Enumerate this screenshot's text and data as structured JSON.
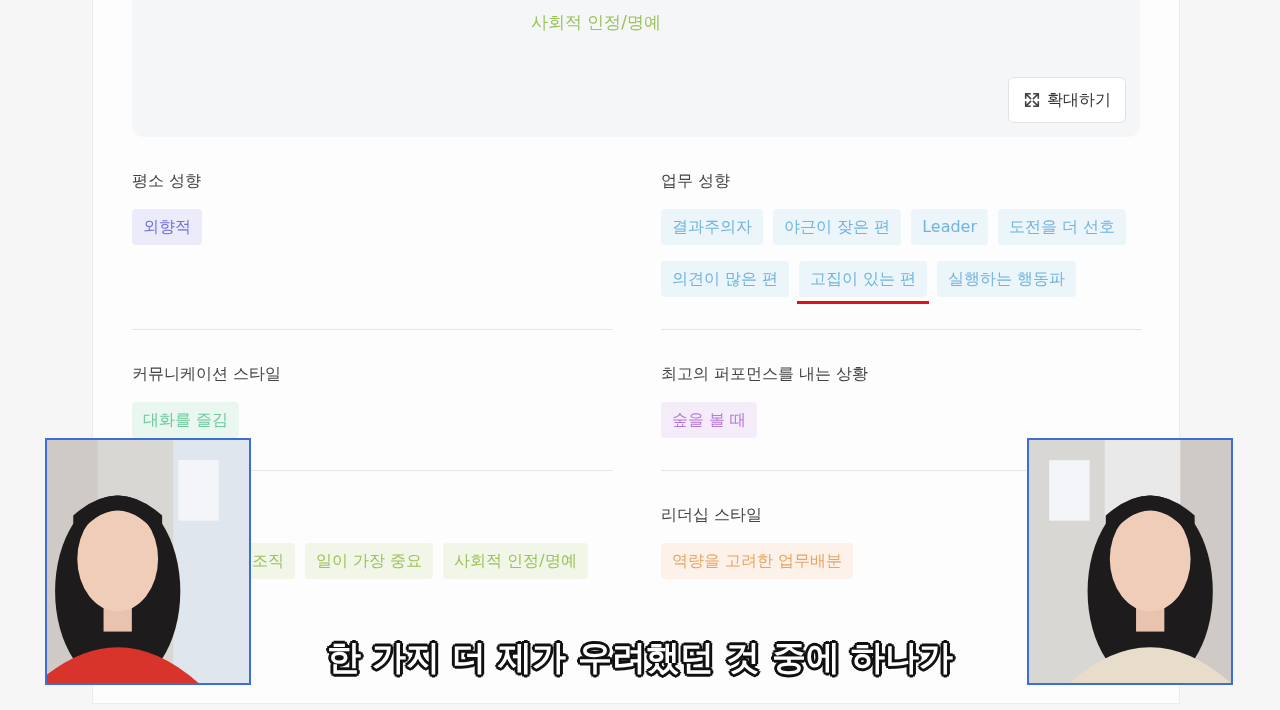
{
  "graph_panel": {
    "label": "사회적 인정/명예",
    "color": "#9cc25a",
    "expand_button": "확대하기"
  },
  "sections": [
    {
      "title": "평소 성향",
      "tags": [
        {
          "label": "외향적",
          "color": "#6f72d8",
          "underlined": false
        }
      ]
    },
    {
      "title": "업무 성향",
      "tags": [
        {
          "label": "결과주의자",
          "color": "#72b4de",
          "underlined": false
        },
        {
          "label": "야근이 잦은 편",
          "color": "#72b4de",
          "underlined": false
        },
        {
          "label": "Leader",
          "color": "#72b4de",
          "underlined": false
        },
        {
          "label": "도전을 더 선호",
          "color": "#72b4de",
          "underlined": false
        },
        {
          "label": "의견이 많은 편",
          "color": "#72b4de",
          "underlined": false
        },
        {
          "label": "고집이 있는 편",
          "color": "#72b4de",
          "underlined": true
        },
        {
          "label": "실행하는 행동파",
          "color": "#72b4de",
          "underlined": false
        }
      ]
    },
    {
      "title": "커뮤니케이션 스타일",
      "tags": [
        {
          "label": "대화를 즐김",
          "color": "#6cc89c",
          "underlined": false
        }
      ]
    },
    {
      "title": "최고의 퍼포먼스를 내는 상황",
      "tags": [
        {
          "label": "숲을 볼 때",
          "color": "#b67ad8",
          "underlined": false
        }
      ]
    },
    {
      "tags": [
        {
          "label": "조직",
          "color": "#9cc25a",
          "underlined": false,
          "kind": "partial"
        },
        {
          "label": "일이 가장 중요",
          "color": "#9cc25a",
          "underlined": false
        },
        {
          "label": "사회적 인정/명예",
          "color": "#9cc25a",
          "underlined": false
        }
      ]
    },
    {
      "title": "리더십 스타일",
      "tags": [
        {
          "label": "역량을 고려한 업무배분",
          "color": "#eba462",
          "underlined": false
        }
      ]
    }
  ],
  "subtitle": "한 가지 더 제가 우려했던 것 중에 하나가"
}
